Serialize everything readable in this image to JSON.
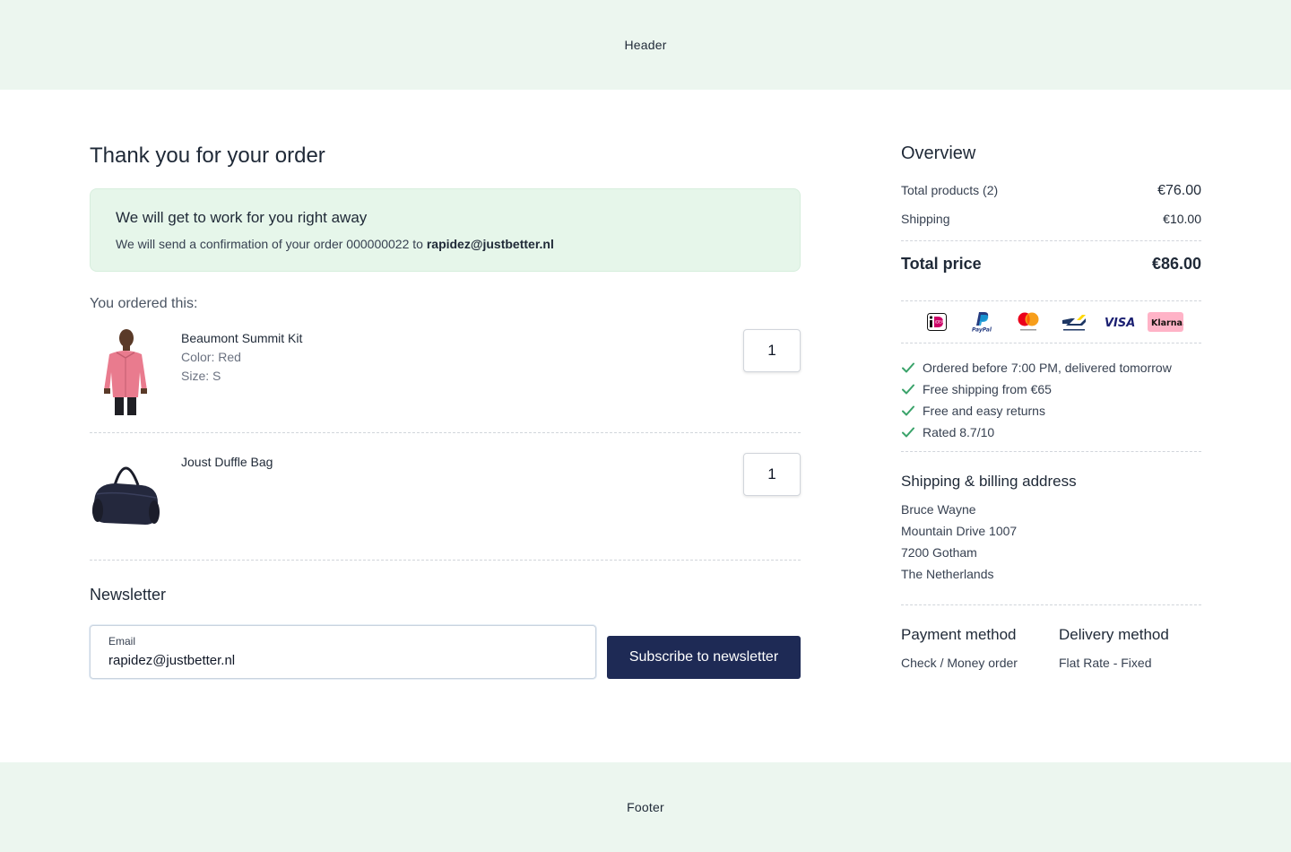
{
  "header": {
    "label": "Header"
  },
  "footer": {
    "label": "Footer"
  },
  "main": {
    "title": "Thank you for your order",
    "notice": {
      "heading": "We will get to work for you right away",
      "text_prefix": "We will send a confirmation of your order 000000022 to ",
      "email": "rapidez@justbetter.nl"
    },
    "ordered_label": "You ordered this:",
    "products": [
      {
        "name": "Beaumont Summit Kit",
        "color": "Color: Red",
        "size": "Size: S",
        "qty": "1",
        "image": "pink-jacket-photo"
      },
      {
        "name": "Joust Duffle Bag",
        "qty": "1",
        "image": "black-duffle-bag-photo"
      }
    ],
    "newsletter": {
      "title": "Newsletter",
      "email_label": "Email",
      "email_value": "rapidez@justbetter.nl",
      "button_label": "Subscribe to newsletter"
    }
  },
  "overview": {
    "title": "Overview",
    "products_label": "Total products (2)",
    "products_amount": "€76.00",
    "shipping_label": "Shipping",
    "shipping_amount": "€10.00",
    "total_label": "Total price",
    "total_amount": "€86.00",
    "payment_icons": [
      "ideal-icon",
      "paypal-icon",
      "mastercard-icon",
      "bancontact-icon",
      "visa-icon",
      "klarna-icon"
    ],
    "payment_icon_text": {
      "paypal": "PayPal",
      "visa": "VISA",
      "klarna": "Klarna."
    },
    "usps": [
      "Ordered before 7:00 PM, delivered tomorrow",
      "Free shipping from €65",
      "Free and easy returns",
      "Rated 8.7/10"
    ],
    "address": {
      "title": "Shipping & billing address",
      "lines": [
        "Bruce Wayne",
        "Mountain Drive 1007",
        "7200 Gotham",
        "The Netherlands"
      ]
    },
    "payment_method": {
      "title": "Payment method",
      "value": "Check / Money order"
    },
    "delivery_method": {
      "title": "Delivery method",
      "value": "Flat Rate - Fixed"
    }
  },
  "colors": {
    "header_bg": "#ecf6ef",
    "notice_bg": "#e6f6ea",
    "button_bg": "#1e2a55",
    "check_green": "#3aa36a"
  }
}
